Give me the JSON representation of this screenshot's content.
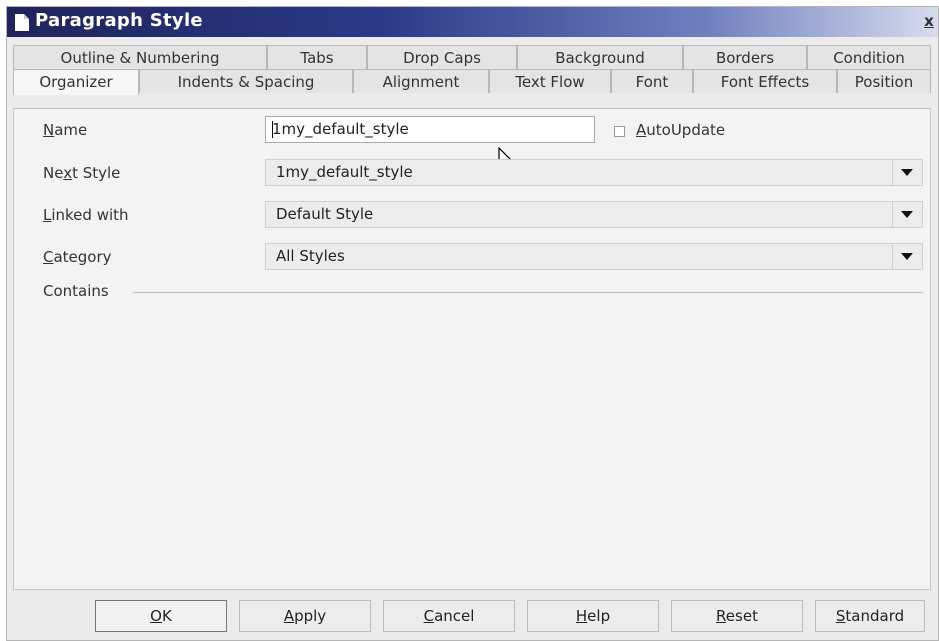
{
  "window": {
    "title": "Paragraph Style",
    "close_label": "x"
  },
  "tabs": {
    "row1": [
      "Outline & Numbering",
      "Tabs",
      "Drop Caps",
      "Background",
      "Borders",
      "Condition"
    ],
    "row2": [
      "Organizer",
      "Indents & Spacing",
      "Alignment",
      "Text Flow",
      "Font",
      "Font Effects",
      "Position"
    ],
    "active": "Organizer"
  },
  "organizer": {
    "name": {
      "label_u": "N",
      "label_rest": "ame",
      "value": "1my_default_style"
    },
    "autoupdate": {
      "label_u": "A",
      "label_rest": "utoUpdate",
      "checked": false
    },
    "next_style": {
      "label_pre": "Ne",
      "label_u": "x",
      "label_rest": "t Style",
      "value": "1my_default_style"
    },
    "linked_with": {
      "label_u": "L",
      "label_rest": "inked with",
      "value": "Default Style"
    },
    "category": {
      "label_u": "C",
      "label_rest": "ategory",
      "value": "All Styles"
    },
    "contains_label": "Contains"
  },
  "buttons": {
    "ok": {
      "u": "O",
      "rest": "K"
    },
    "apply": {
      "u": "A",
      "rest": "pply"
    },
    "cancel": {
      "u": "C",
      "rest": "ancel"
    },
    "help": {
      "u": "H",
      "rest": "elp"
    },
    "reset": {
      "u": "R",
      "rest": "eset"
    },
    "standard": {
      "u": "S",
      "rest": "tandard"
    }
  },
  "colors": {
    "titlebar_start": "#20235c",
    "titlebar_end": "#d6dbee",
    "dialog_bg": "#ebebeb"
  }
}
